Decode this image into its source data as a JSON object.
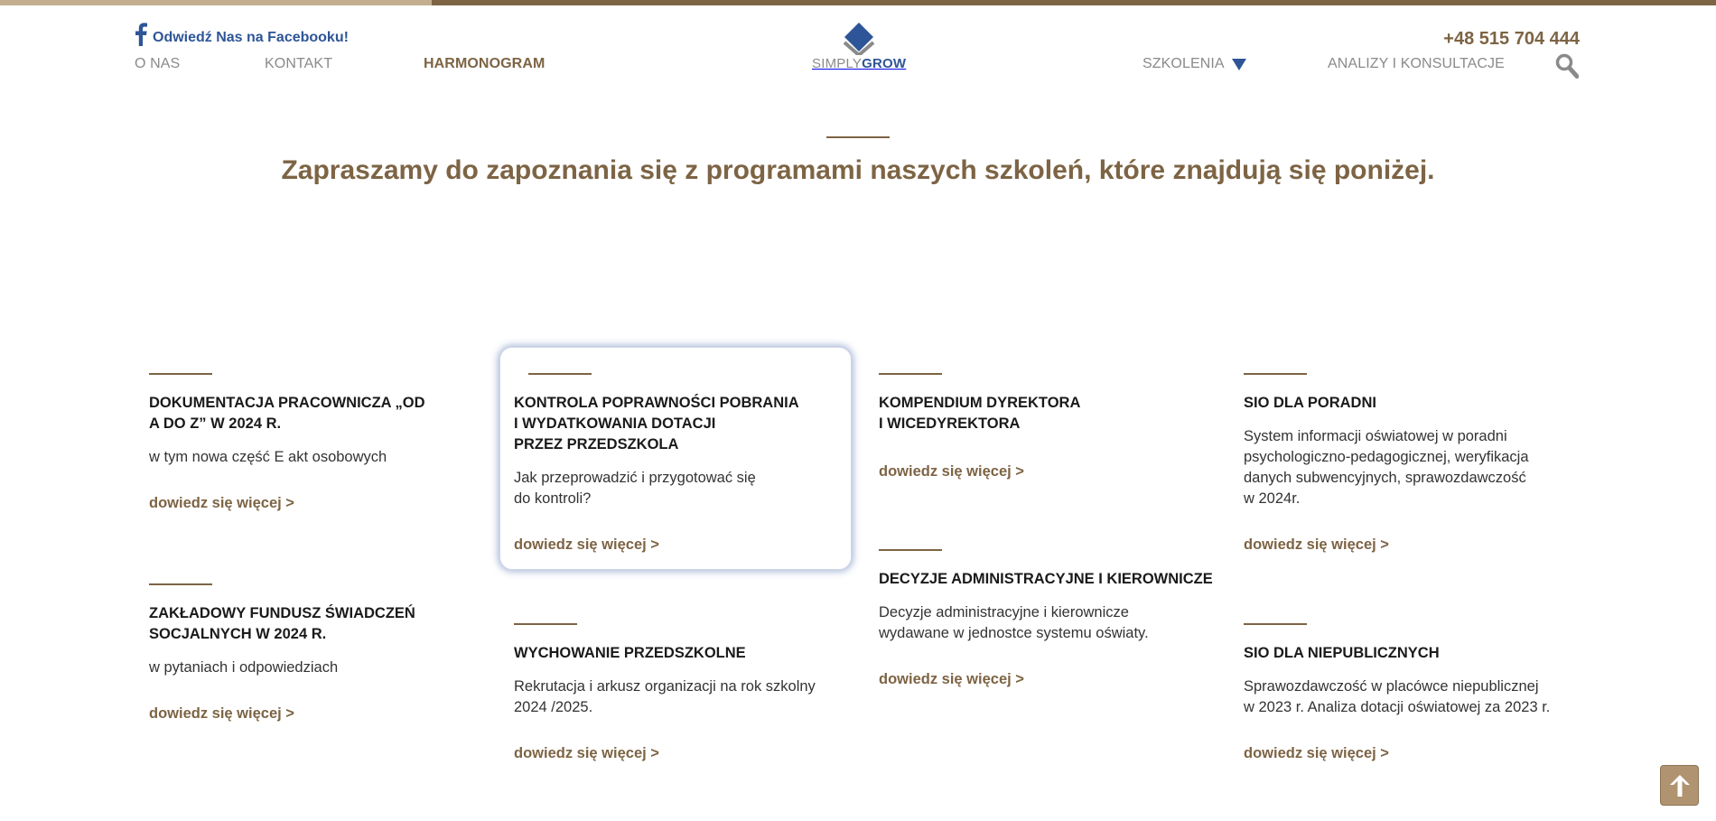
{
  "header": {
    "facebook_label": "Odwiedź Nas na Facebooku!",
    "phone": "+48 515 704 444",
    "logo": {
      "part1": "SIMPLY",
      "part2": "GROW"
    },
    "nav": {
      "o_nas": "O NAS",
      "kontakt": "KONTAKT",
      "harmonogram": "HARMONOGRAM",
      "szkolenia": "SZKOLENIA",
      "analizy": "ANALIZY I KONSULTACJE"
    }
  },
  "intro": "Zapraszamy do zapoznania się z programami naszych szkoleń, które znajdują się poniżej.",
  "cards": [
    {
      "title": "DOKUMENTACJA PRACOWNICZA „OD\nA DO Z” W 2024 R.",
      "desc": "w tym nowa część E akt osobowych",
      "more": "dowiedz się więcej >"
    },
    {
      "title": "KONTROLA POPRAWNOŚCI POBRANIA\nI WYDATKOWANIA DOTACJI\nPRZEZ PRZEDSZKOLA",
      "desc": "Jak przeprowadzić i przygotować się\ndo kontroli?",
      "more": "dowiedz się więcej >"
    },
    {
      "title": "KOMPENDIUM DYREKTORA\nI WICEDYREKTORA",
      "desc": "",
      "more": "dowiedz się więcej >"
    },
    {
      "title": "SIO DLA PORADNI",
      "desc": "System informacji oświatowej w poradni\npsychologiczno-pedagogicznej, weryfikacja\ndanych subwencyjnych, sprawozdawczość\nw 2024r.",
      "more": "dowiedz się więcej >"
    },
    {
      "title": "ZAKŁADOWY FUNDUSZ ŚWIADCZEŃ\nSOCJALNYCH W 2024 R.",
      "desc": "w pytaniach i odpowiedziach",
      "more": "dowiedz się więcej >"
    },
    {
      "title": "WYCHOWANIE PRZEDSZKOLNE",
      "desc": "Rekrutacja i arkusz organizacji na rok szkolny\n2024 /2025.",
      "more": "dowiedz się więcej >"
    },
    {
      "title": "DECYZJE ADMINISTRACYJNE I KIEROWNICZE",
      "desc": "Decyzje administracyjne i kierownicze\nwydawane w jednostce systemu oświaty.",
      "more": "dowiedz się więcej >"
    },
    {
      "title": "SIO DLA NIEPUBLICZNYCH",
      "desc": "Sprawozdawczość w placówce niepublicznej\nw 2023 r. Analiza dotacji oświatowej za 2023 r.",
      "more": "dowiedz się więcej >"
    }
  ],
  "icons": {
    "facebook": "facebook-icon",
    "dropdown": "triangle-down-icon",
    "search": "magnifier-icon",
    "back_to_top": "arrow-up-icon"
  },
  "colors": {
    "brand_brown": "#7d6444",
    "brand_blue": "#2e5597",
    "nav_gray": "#8a8a8a"
  }
}
